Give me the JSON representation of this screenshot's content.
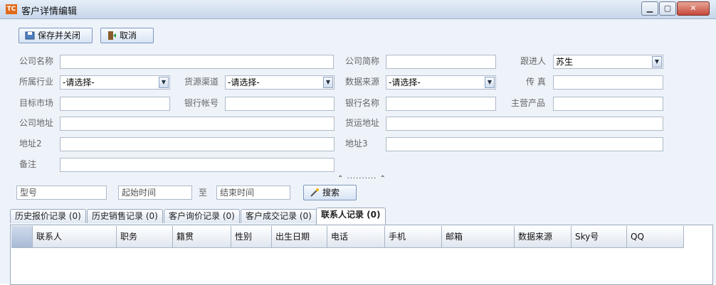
{
  "window": {
    "title": "客户详情编辑",
    "app_icon_text": "TC"
  },
  "toolbar": {
    "save_close": "保存并关闭",
    "cancel": "取消"
  },
  "form": {
    "company_name": {
      "label": "公司名称",
      "value": ""
    },
    "company_short": {
      "label": "公司简称",
      "value": ""
    },
    "follower": {
      "label": "跟进人",
      "value": "苏生"
    },
    "industry": {
      "label": "所属行业",
      "value": "-请选择-"
    },
    "supply_channel": {
      "label": "货源渠道",
      "value": "-请选择-"
    },
    "data_source": {
      "label": "数据来源",
      "value": "-请选择-"
    },
    "fax": {
      "label": "传 真",
      "value": ""
    },
    "target_market": {
      "label": "目标市场",
      "value": ""
    },
    "bank_account": {
      "label": "银行帐号",
      "value": ""
    },
    "bank_name": {
      "label": "银行名称",
      "value": ""
    },
    "main_product": {
      "label": "主营产品",
      "value": ""
    },
    "company_address": {
      "label": "公司地址",
      "value": ""
    },
    "shipping_address": {
      "label": "货运地址",
      "value": ""
    },
    "address2": {
      "label": "地址2",
      "value": ""
    },
    "address3": {
      "label": "地址3",
      "value": ""
    },
    "remark": {
      "label": "备注",
      "value": ""
    }
  },
  "collapse_handle": "⌃ ·········· ⌃",
  "search": {
    "model_placeholder": "型号",
    "start_placeholder": "起始时间",
    "to_label": "至",
    "end_placeholder": "结束时间",
    "button": "搜索"
  },
  "tabs": [
    {
      "label": "历史报价记录 (0)"
    },
    {
      "label": "历史销售记录 (0)"
    },
    {
      "label": "客户询价记录 (0)"
    },
    {
      "label": "客户成交记录 (0)"
    },
    {
      "label": "联系人记录 (0)"
    }
  ],
  "grid": {
    "columns": [
      "联系人",
      "职务",
      "籍贯",
      "性别",
      "出生日期",
      "电话",
      "手机",
      "邮箱",
      "数据来源",
      "Sky号",
      "QQ"
    ]
  },
  "colors": {
    "panel": "#eef3fa",
    "accent": "#e06a1b"
  }
}
